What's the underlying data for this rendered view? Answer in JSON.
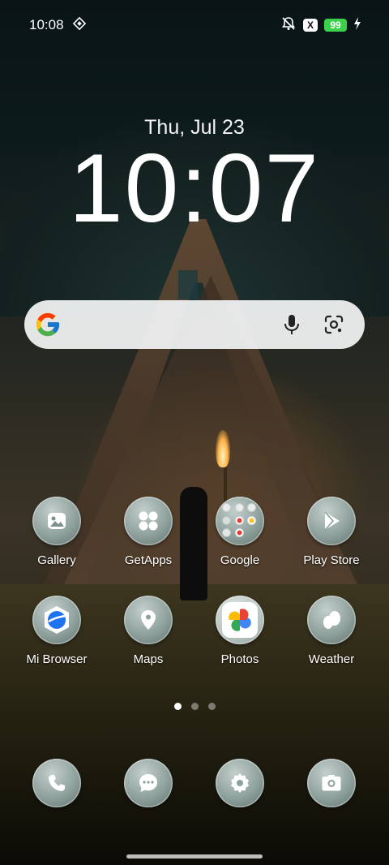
{
  "status_bar": {
    "time": "10:08",
    "battery_level": "99",
    "sim_badge": "X",
    "icons": [
      "data-saver-icon",
      "silent-mode-icon",
      "no-sim-icon",
      "battery-icon",
      "charging-icon"
    ]
  },
  "lock_widget": {
    "date": "Thu, Jul 23",
    "time": "10:07"
  },
  "search_bar": {
    "icons": [
      "google-g-icon",
      "microphone-icon",
      "google-lens-icon"
    ]
  },
  "apps_row1": [
    {
      "label": "Gallery",
      "icon": "gallery-icon"
    },
    {
      "label": "GetApps",
      "icon": "getapps-icon"
    },
    {
      "label": "Google",
      "icon": "folder-icon"
    },
    {
      "label": "Play Store",
      "icon": "play-store-icon"
    }
  ],
  "apps_row2": [
    {
      "label": "Mi Browser",
      "icon": "mi-browser-icon"
    },
    {
      "label": "Maps",
      "icon": "maps-icon"
    },
    {
      "label": "Photos",
      "icon": "photos-icon"
    },
    {
      "label": "Weather",
      "icon": "weather-icon"
    }
  ],
  "dock": [
    {
      "icon": "phone-icon"
    },
    {
      "icon": "messages-icon"
    },
    {
      "icon": "settings-icon"
    },
    {
      "icon": "camera-icon"
    }
  ],
  "pager": {
    "pages": 3,
    "current": 1
  },
  "colors": {
    "battery": "#3ad24a",
    "search_bar_bg": "#eef0f0",
    "app_icon_bg": "#8fa19d"
  }
}
